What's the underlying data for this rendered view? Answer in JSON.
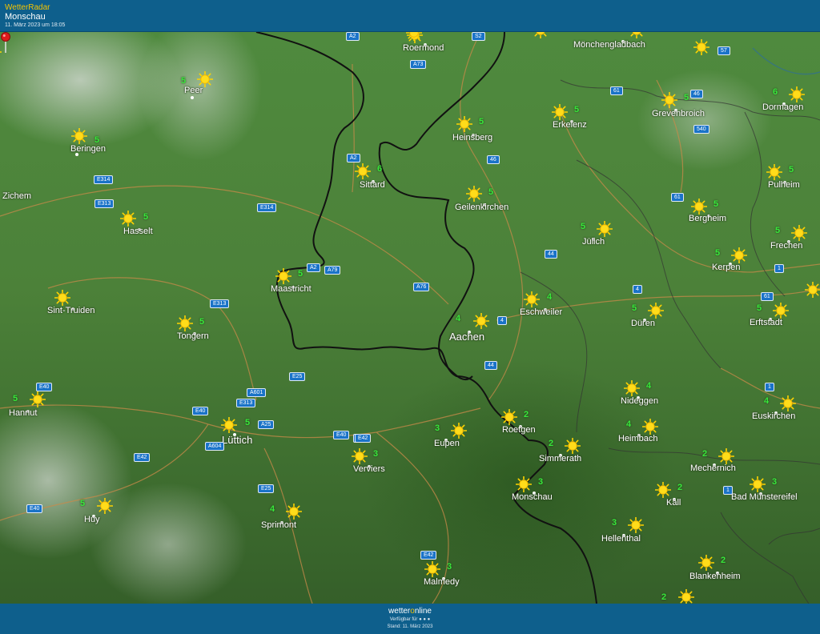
{
  "header": {
    "brand": "WetterRadar",
    "location": "Monschau",
    "timestamp": "11. März 2023 um 18:05"
  },
  "map": {
    "condition_icon": "sun-icon",
    "colors": {
      "temperature": "#38e83a",
      "road_sign": "#1a73c8",
      "border": "#111111",
      "pin": "#e01b1b"
    },
    "places": [
      {
        "id": "peer",
        "name": "Peer",
        "temp": "5"
      },
      {
        "id": "beringen",
        "name": "Beringen",
        "temp": "5"
      },
      {
        "id": "zichem",
        "name": "Zichem",
        "temp": ""
      },
      {
        "id": "hasselt",
        "name": "Hasselt",
        "temp": "5"
      },
      {
        "id": "sint-truiden",
        "name": "Sint-Truiden",
        "temp": ""
      },
      {
        "id": "tongern",
        "name": "Tongern",
        "temp": "5"
      },
      {
        "id": "hannut",
        "name": "Hannut",
        "temp": "5"
      },
      {
        "id": "luettich",
        "name": "Lüttich",
        "temp": "5"
      },
      {
        "id": "huy",
        "name": "Huy",
        "temp": "5"
      },
      {
        "id": "sprimont",
        "name": "Sprimont",
        "temp": "4"
      },
      {
        "id": "verviers",
        "name": "Verviers",
        "temp": "3"
      },
      {
        "id": "maastricht",
        "name": "Maastricht",
        "temp": "5"
      },
      {
        "id": "sittard",
        "name": "Sittard",
        "temp": "6"
      },
      {
        "id": "roermond",
        "name": "Roermond",
        "temp": ""
      },
      {
        "id": "heinsberg",
        "name": "Heinsberg",
        "temp": "5"
      },
      {
        "id": "geilenkirchen",
        "name": "Geilenkirchen",
        "temp": "5"
      },
      {
        "id": "erkelenz",
        "name": "Erkelenz",
        "temp": "5"
      },
      {
        "id": "moenchengladbach",
        "name": "Mönchengladbach",
        "temp": ""
      },
      {
        "id": "grevenbroich",
        "name": "Grevenbroich",
        "temp": "5"
      },
      {
        "id": "dormagen",
        "name": "Dormagen",
        "temp": "6"
      },
      {
        "id": "pulheim",
        "name": "Pulheim",
        "temp": "5"
      },
      {
        "id": "bergheim",
        "name": "Bergheim",
        "temp": "5"
      },
      {
        "id": "frechen",
        "name": "Frechen",
        "temp": "5"
      },
      {
        "id": "kerpen",
        "name": "Kerpen",
        "temp": "5"
      },
      {
        "id": "juelich",
        "name": "Jülich",
        "temp": "5"
      },
      {
        "id": "aachen",
        "name": "Aachen",
        "temp": "4"
      },
      {
        "id": "eschweiler",
        "name": "Eschweiler",
        "temp": "4"
      },
      {
        "id": "dueren",
        "name": "Düren",
        "temp": "5"
      },
      {
        "id": "erftstadt",
        "name": "Erftstadt",
        "temp": "5"
      },
      {
        "id": "nideggen",
        "name": "Nideggen",
        "temp": "4"
      },
      {
        "id": "euskirchen",
        "name": "Euskirchen",
        "temp": "4"
      },
      {
        "id": "heimbach",
        "name": "Heimbach",
        "temp": "4"
      },
      {
        "id": "roetgen",
        "name": "Roetgen",
        "temp": "2"
      },
      {
        "id": "eupen",
        "name": "Eupen",
        "temp": "3"
      },
      {
        "id": "simmerath",
        "name": "Simmerath",
        "temp": "2"
      },
      {
        "id": "monschau",
        "name": "Monschau",
        "temp": "3"
      },
      {
        "id": "mechernich",
        "name": "Mechernich",
        "temp": "2"
      },
      {
        "id": "kall",
        "name": "Kall",
        "temp": "2"
      },
      {
        "id": "bad-muenstereifel",
        "name": "Bad Münstereifel",
        "temp": "3"
      },
      {
        "id": "hellenthal",
        "name": "Hellenthal",
        "temp": "3"
      },
      {
        "id": "blankenheim",
        "name": "Blankenheim",
        "temp": "2"
      },
      {
        "id": "malmedy",
        "name": "Malmedy",
        "temp": "3"
      }
    ],
    "extra_temps": [
      "2"
    ],
    "roads": [
      "A2",
      "S2",
      "A73",
      "61",
      "46",
      "57",
      "540",
      "A2",
      "46",
      "E314",
      "E313",
      "E314",
      "61",
      "A2",
      "A79",
      "44",
      "A76",
      "4",
      "1",
      "E313",
      "61",
      "4",
      "E25",
      "E40",
      "A601",
      "E313",
      "E40",
      "A25",
      "E40",
      "E42",
      "A604",
      "E42",
      "E40",
      "44",
      "E25",
      "E42",
      "E42",
      "1",
      "1"
    ]
  },
  "footer": {
    "logo_prefix": "wetter",
    "logo_o": "o",
    "logo_suffix": "nline",
    "available": "Verfügbar für",
    "available_icons": [
      "android-icon",
      "apple-icon",
      "windows-icon"
    ],
    "stand": "Stand: 11. März 2023"
  }
}
